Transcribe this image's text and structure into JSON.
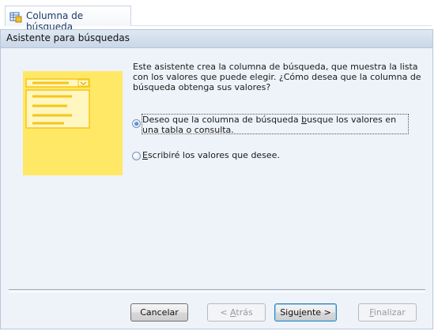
{
  "tab": {
    "title": "Columna de búsqueda",
    "icon": "table-lookup-icon"
  },
  "dialog": {
    "title": "Asistente para búsquedas",
    "illustration_icon": "lookup-list-illustration",
    "description": "Este asistente crea la columna de búsqueda, que muestra la lista con los valores que puede elegir. ¿Cómo desea que la columna de búsqueda obtenga sus valores?",
    "options": [
      {
        "pre": "Deseo que la columna de búsqueda ",
        "accel": "b",
        "post": "usque los valores en una tabla o consulta.",
        "selected": true
      },
      {
        "pre": "",
        "accel": "E",
        "post": "scribiré los valores que desee.",
        "selected": false
      }
    ]
  },
  "buttons": {
    "cancel": {
      "label": "Cancelar"
    },
    "back": {
      "pre": "< ",
      "accel": "A",
      "post": "trás",
      "enabled": false
    },
    "next": {
      "pre": "Sigu",
      "accel": "i",
      "post": "ente >",
      "enabled": true
    },
    "finish": {
      "pre": "",
      "accel": "F",
      "post": "inalizar",
      "enabled": false
    }
  },
  "colors": {
    "illustration_bg": "#ffe866",
    "illustration_frame": "#f5c518",
    "accent": "#3c7fb1"
  }
}
